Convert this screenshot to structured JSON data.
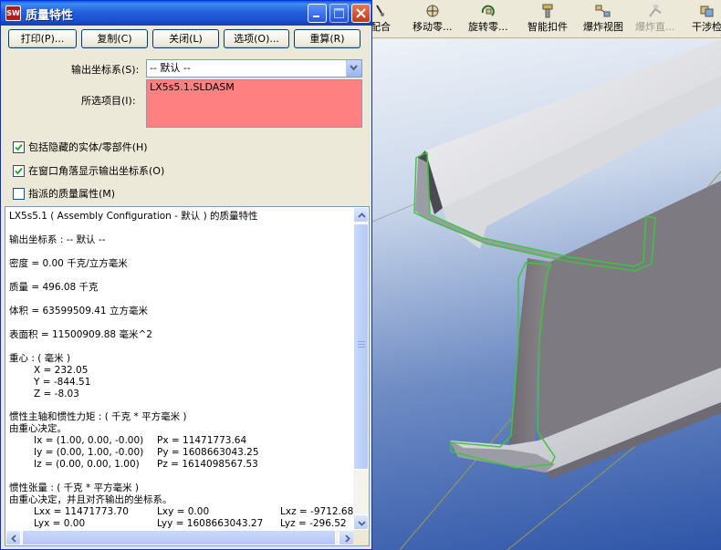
{
  "dialog": {
    "title": "质量特性",
    "app_icon": "SW",
    "buttons": {
      "print": "打印(P)...",
      "copy": "复制(C)",
      "close": "关闭(L)",
      "options": "选项(O)...",
      "recalc": "重算(R)"
    },
    "coord_label": "输出坐标系(S):",
    "coord_value": "-- 默认 --",
    "selected_label": "所选项目(I):",
    "selected_item": "LX5s5.1.SLDASM",
    "checkboxes": [
      {
        "label": "包括隐藏的实体/零部件(H)",
        "checked": true
      },
      {
        "label": "在窗口角落显示输出坐标系(O)",
        "checked": true
      },
      {
        "label": "指派的质量属性(M)",
        "checked": false
      }
    ],
    "results": {
      "heading": "LX5s5.1 ( Assembly Configuration - 默认 ) 的质量特性",
      "coord": "输出坐标系 : -- 默认 --",
      "density": "密度 = 0.00 千克/立方毫米",
      "mass": "质量 = 496.08 千克",
      "volume": "体积 = 63599509.41 立方毫米",
      "area": "表面积 = 11500909.88 毫米^2",
      "cog_title": "重心 : ( 毫米 )",
      "cog_x": "X = 232.05",
      "cog_y": "Y = -844.51",
      "cog_z": "Z = -8.03",
      "principal_title": "惯性主轴和惯性力矩 : ( 千克 * 平方毫米 )",
      "principal_note": "由重心决定。",
      "ix": "Ix = (1.00, 0.00, -0.00)",
      "iy": "Iy = (0.00, 1.00, -0.00)",
      "iz": "Iz = (0.00, 0.00, 1.00)",
      "px": "Px = 11471773.64",
      "py": "Py = 1608663043.25",
      "pz": "Pz = 1614098567.53",
      "tensor_title": "惯性张量 : ( 千克 * 平方毫米 )",
      "tensor_note": "由重心决定，并且对齐输出的坐标系。",
      "lxx": "Lxx = 11471773.70",
      "lxy": "Lxy = 0.00",
      "lxz": "Lxz = -9712.68",
      "lyx": "Lyx = 0.00",
      "lyy": "Lyy = 1608663043.27",
      "lyz": "Lyz = -296.52"
    }
  },
  "toolbar": {
    "items": [
      {
        "label": "配合",
        "icon": "mate-icon"
      },
      {
        "label": "移动零...",
        "icon": "move-component-icon"
      },
      {
        "label": "旋转零...",
        "icon": "rotate-component-icon"
      },
      {
        "label": "智能扣件",
        "icon": "smart-fastener-icon"
      },
      {
        "label": "爆炸视图",
        "icon": "exploded-view-icon"
      },
      {
        "label": "爆炸直...",
        "icon": "explode-line-icon",
        "disabled": true
      },
      {
        "label": "干涉检",
        "icon": "interference-icon"
      }
    ]
  },
  "colors": {
    "titlebar": "#2360dc",
    "selected_box": "#ff8080",
    "viewport_bottom": "#2e55a8",
    "edge_highlight": "#3dc63d"
  }
}
